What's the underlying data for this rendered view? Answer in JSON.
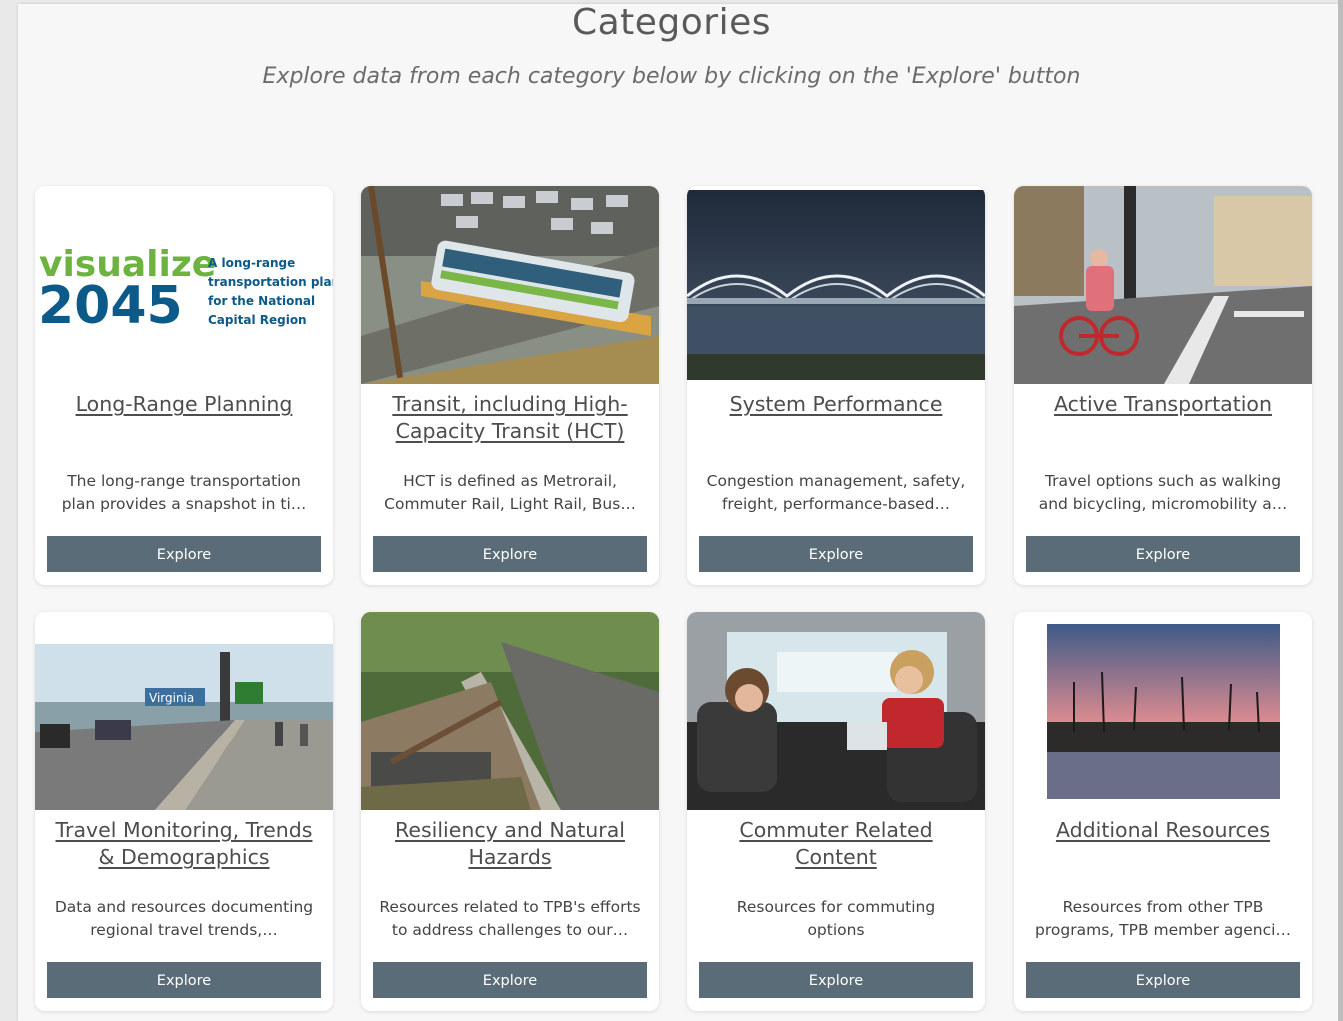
{
  "header": {
    "title": "Categories",
    "subtitle": "Explore data from each category below by clicking on the 'Explore' button"
  },
  "colors": {
    "button": "#5a6c78",
    "card": "#ffffff",
    "background": "#f7f7f7"
  },
  "cards": [
    {
      "title_lines": [
        "Long-Range Planning"
      ],
      "desc_lines": [
        "The long-range transportation",
        "plan provides a snapshot in ti…"
      ],
      "button": "Explore",
      "image": "visualize-2045-logo",
      "logo": {
        "word1": "visualize",
        "word2": "2045",
        "tagline": [
          "A long-range",
          "transportation plan",
          "for the National",
          "Capital Region"
        ]
      }
    },
    {
      "title_lines": [
        "Transit, including High-",
        "Capacity Transit (HCT)"
      ],
      "desc_lines": [
        "HCT is defined as Metrorail,",
        "Commuter Rail, Light Rail, Bus…"
      ],
      "button": "Explore",
      "image": "bus-photo"
    },
    {
      "title_lines": [
        "System Performance"
      ],
      "desc_lines": [
        "Congestion management, safety,",
        "freight, performance-based…"
      ],
      "button": "Explore",
      "image": "bridge-photo"
    },
    {
      "title_lines": [
        "Active Transportation"
      ],
      "desc_lines": [
        "Travel options such as walking",
        "and bicycling, micromobility a…"
      ],
      "button": "Explore",
      "image": "cyclist-photo"
    },
    {
      "title_lines": [
        "Travel Monitoring, Trends",
        "& Demographics"
      ],
      "desc_lines": [
        "Data and resources documenting",
        "regional travel trends,…"
      ],
      "button": "Explore",
      "image": "traffic-bridge-photo",
      "sign_text": "Virginia"
    },
    {
      "title_lines": [
        "Resiliency and Natural",
        "Hazards"
      ],
      "desc_lines": [
        "Resources related to TPB's efforts",
        "to address challenges to our…"
      ],
      "button": "Explore",
      "image": "washout-road-photo"
    },
    {
      "title_lines": [
        "Commuter Related",
        "Content"
      ],
      "desc_lines": [
        "Resources for commuting",
        "options"
      ],
      "button": "Explore",
      "image": "vanpool-photo"
    },
    {
      "title_lines": [
        "Additional Resources"
      ],
      "desc_lines": [
        "Resources from other TPB",
        "programs, TPB member agenci…"
      ],
      "button": "Explore",
      "image": "sunset-river-photo"
    }
  ]
}
